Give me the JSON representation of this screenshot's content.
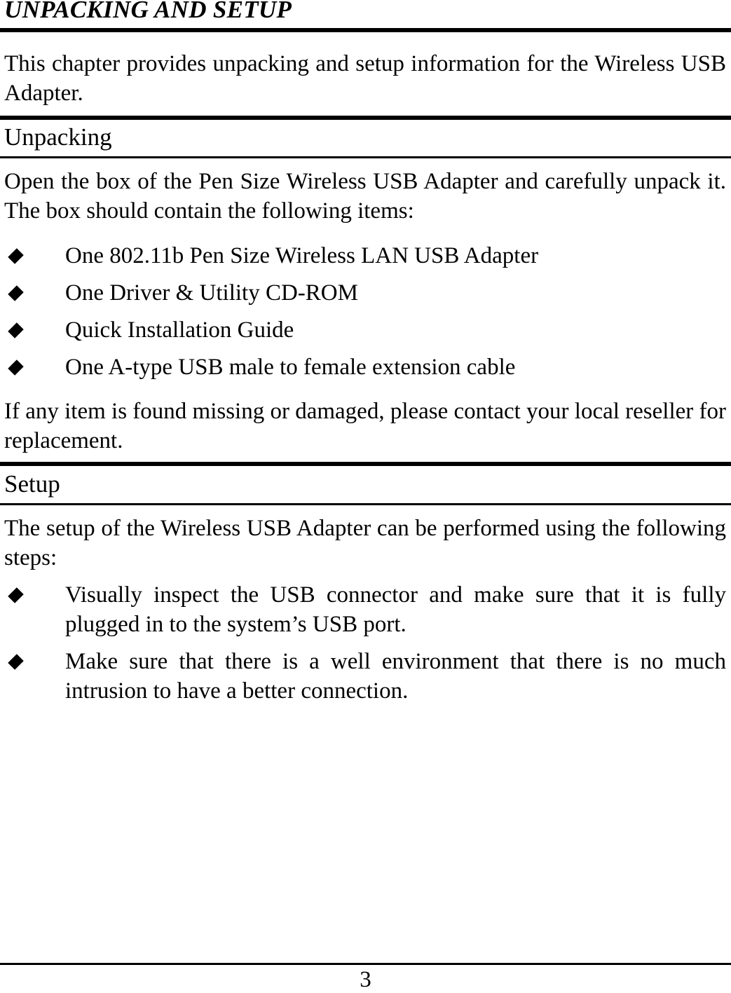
{
  "chapter_title": "UNPACKING AND SETUP",
  "intro": "This chapter provides unpacking and setup information for the Wireless USB Adapter.",
  "sections": {
    "unpacking": {
      "heading": "Unpacking",
      "intro": "Open the box of the Pen Size Wireless USB Adapter and carefully unpack it. The box should contain the following items:",
      "items": [
        "One 802.11b Pen Size Wireless LAN USB Adapter",
        "One Driver & Utility CD-ROM",
        "Quick Installation Guide",
        "One A-type USB male to female extension cable"
      ],
      "note": "If any item is found missing or damaged, please contact your local reseller for replacement."
    },
    "setup": {
      "heading": "Setup",
      "intro": "The setup of the Wireless USB Adapter can be performed using the following steps:",
      "steps": [
        "Visually inspect the USB connector and make sure that it is fully plugged in to the system’s USB port.",
        "Make sure that there is a well environment that there is no much intrusion to have a better connection."
      ]
    }
  },
  "footer": {
    "page_number": "3"
  },
  "icons": {
    "bullet": "diamond-bullet-icon"
  }
}
